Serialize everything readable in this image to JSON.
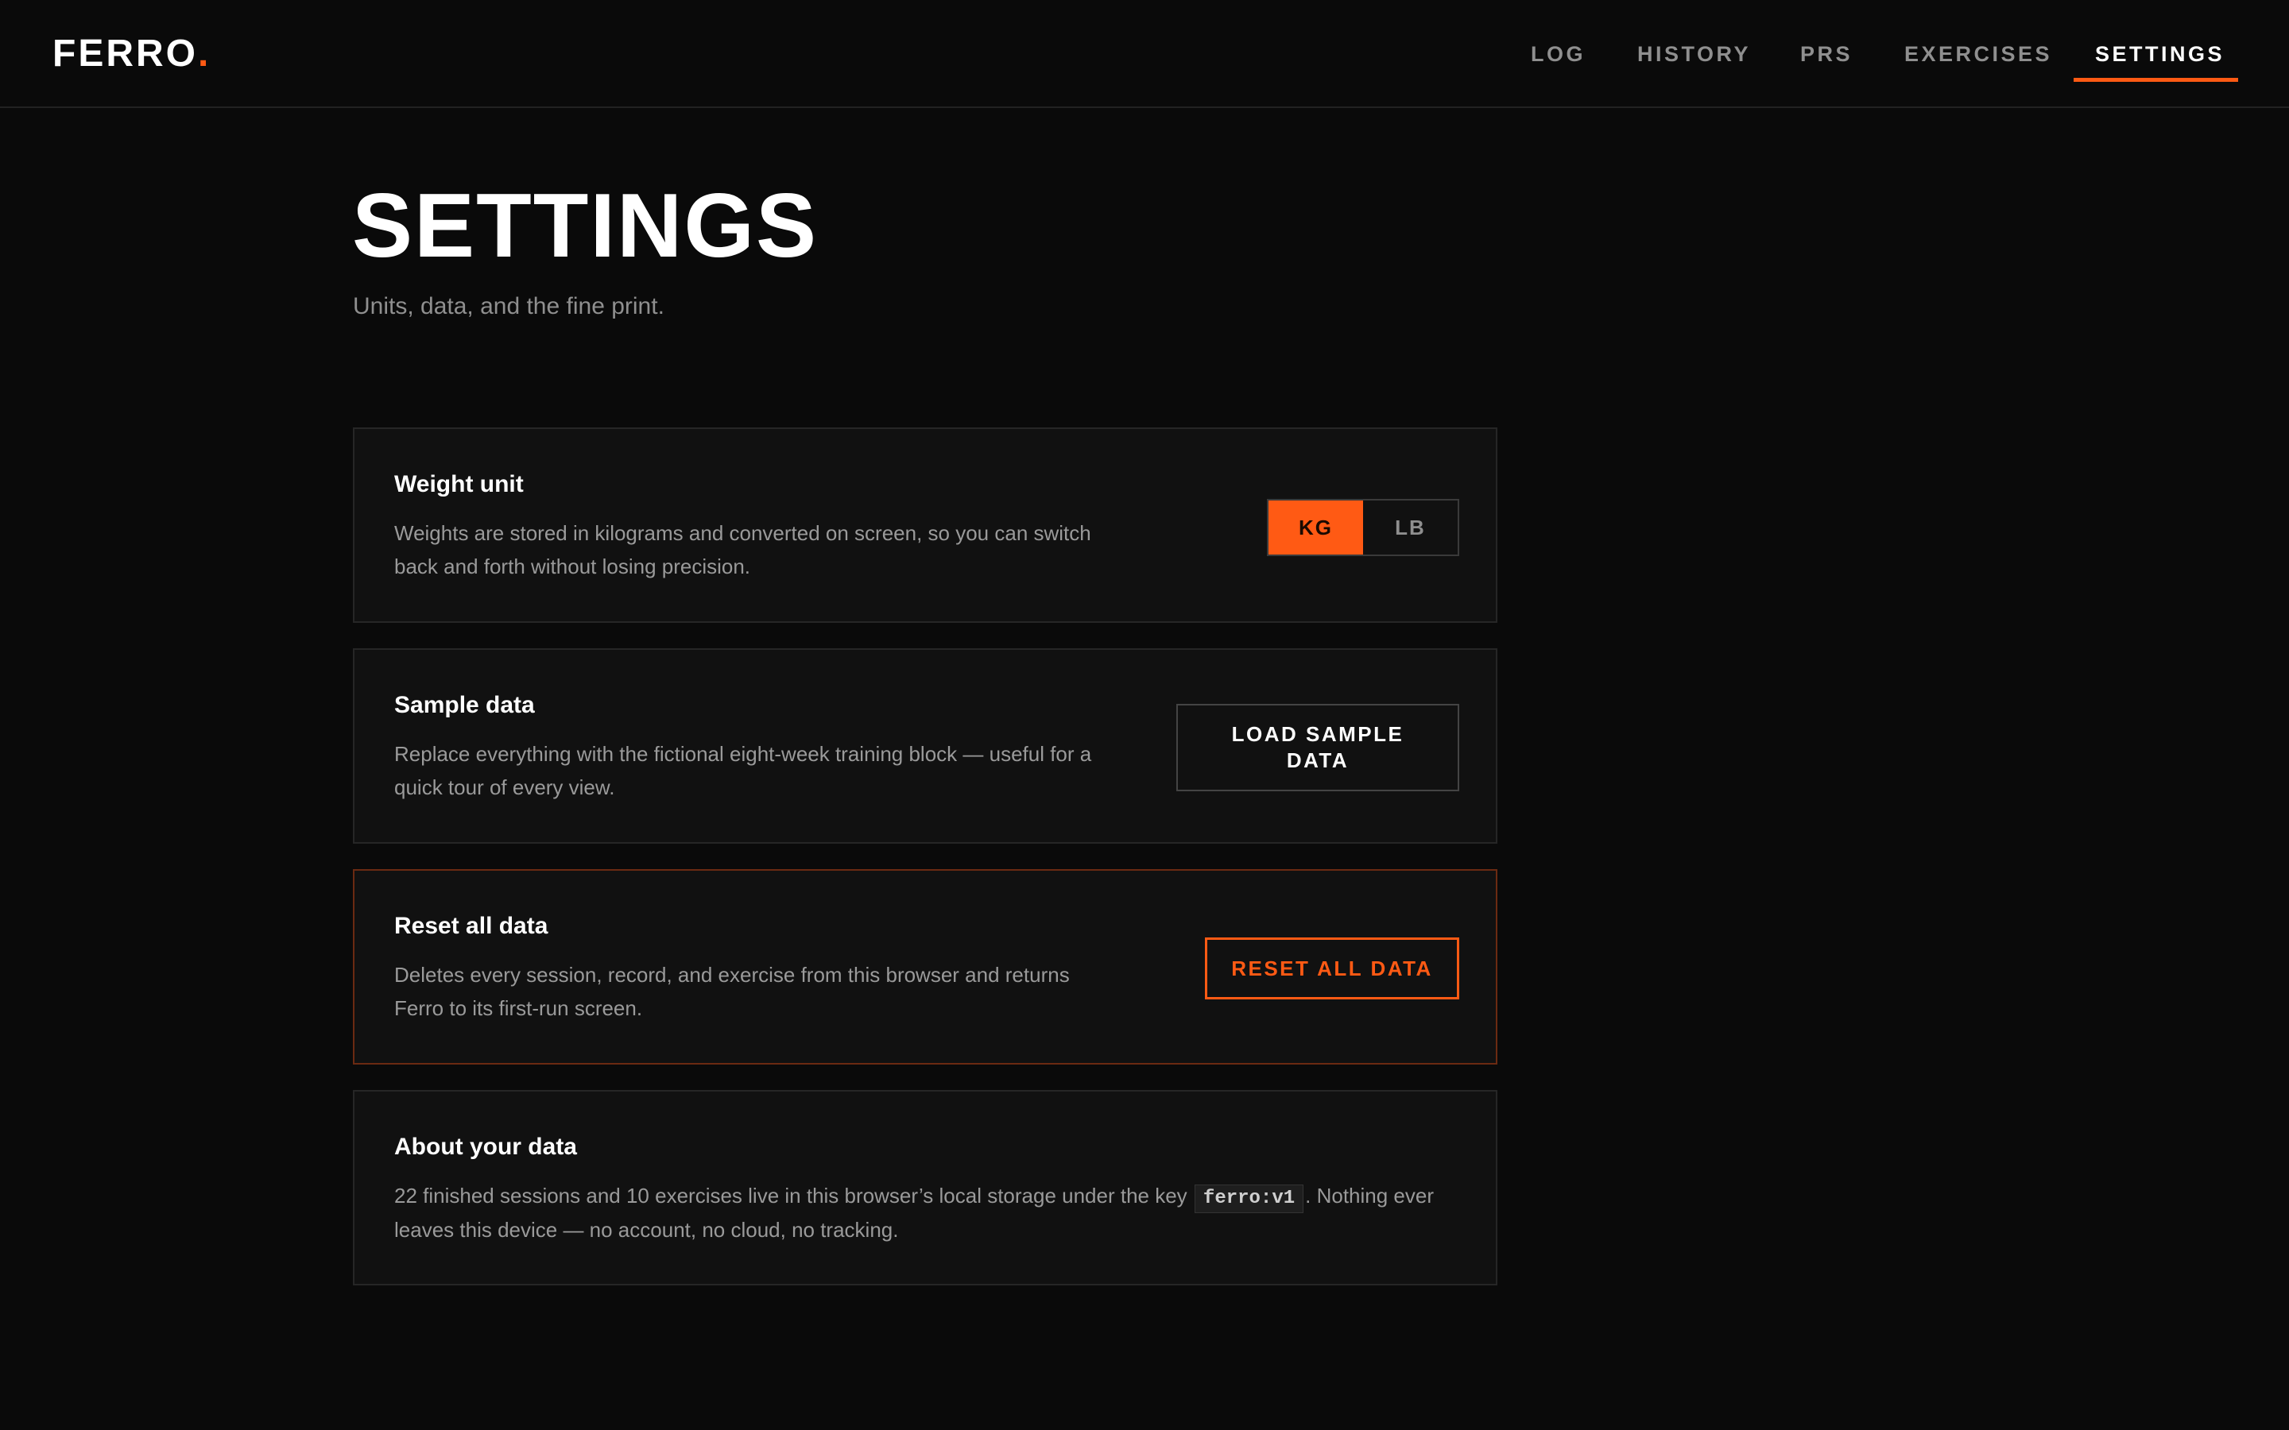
{
  "brand": {
    "name": "FERRO",
    "dot": ".",
    "accent_color": "#ff5a14"
  },
  "nav": {
    "items": [
      {
        "label": "LOG"
      },
      {
        "label": "HISTORY"
      },
      {
        "label": "PRS"
      },
      {
        "label": "EXERCISES"
      },
      {
        "label": "SETTINGS",
        "active": true
      }
    ]
  },
  "page": {
    "title": "SETTINGS",
    "subtitle": "Units, data, and the fine print."
  },
  "weight_unit": {
    "title": "Weight unit",
    "description": "Weights are stored in kilograms and converted on screen, so you can switch back and forth without losing precision.",
    "options": [
      "KG",
      "LB"
    ],
    "selected": "KG"
  },
  "sample_data": {
    "title": "Sample data",
    "description": "Replace everything with the fictional eight-week training block — useful for a quick tour of every view.",
    "button_label": "LOAD SAMPLE DATA"
  },
  "reset": {
    "title": "Reset all data",
    "description": "Deletes every session, record, and exercise from this browser and returns Ferro to its first-run screen.",
    "button_label": "RESET ALL DATA"
  },
  "about": {
    "title": "About your data",
    "text_before": "22 finished sessions and 10 exercises live in this browser’s local storage under the key ",
    "storage_key": "ferro:v1",
    "text_after": ". Nothing ever leaves this device — no account, no cloud, no tracking."
  }
}
